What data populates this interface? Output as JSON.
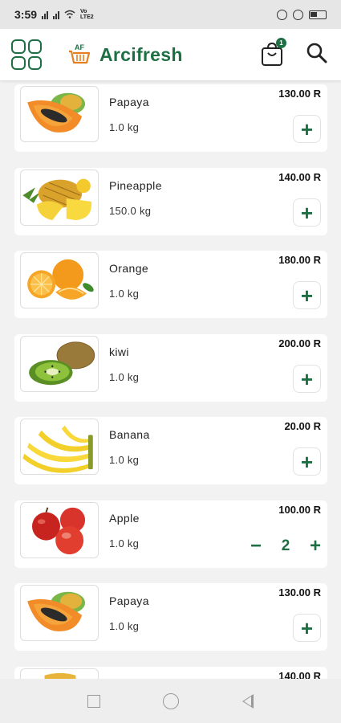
{
  "status_bar": {
    "time": "3:59",
    "network": "Vo LTE2"
  },
  "header": {
    "title": "Arcifresh",
    "logo_text": "AF",
    "cart_count": "1"
  },
  "products": [
    {
      "name": "Papaya",
      "weight": "1.0 kg",
      "price": "130.00 R",
      "image": "papaya",
      "quantity": null
    },
    {
      "name": "Pineapple",
      "weight": "150.0 kg",
      "price": "140.00 R",
      "image": "pineapple",
      "quantity": null
    },
    {
      "name": "Orange",
      "weight": "1.0 kg",
      "price": "180.00 R",
      "image": "orange",
      "quantity": null
    },
    {
      "name": "kiwi",
      "weight": "1.0 kg",
      "price": "200.00 R",
      "image": "kiwi",
      "quantity": null
    },
    {
      "name": "Banana",
      "weight": "1.0 kg",
      "price": "20.00 R",
      "image": "banana",
      "quantity": null
    },
    {
      "name": "Apple",
      "weight": "1.0 kg",
      "price": "100.00 R",
      "image": "apple",
      "quantity": "2"
    },
    {
      "name": "Papaya",
      "weight": "1.0 kg",
      "price": "130.00 R",
      "image": "papaya",
      "quantity": null
    },
    {
      "name": "",
      "weight": "",
      "price": "140.00 R",
      "image": "pineapple",
      "quantity": null
    }
  ],
  "controls": {
    "add_symbol": "+",
    "minus_symbol": "−",
    "plus_symbol": "+"
  },
  "colors": {
    "brand_green": "#1f6f45",
    "background": "#f2f2f2",
    "card": "#ffffff"
  },
  "icons": {
    "menu": "grid-menu-icon",
    "cart": "shopping-bag-icon",
    "search": "search-icon"
  }
}
